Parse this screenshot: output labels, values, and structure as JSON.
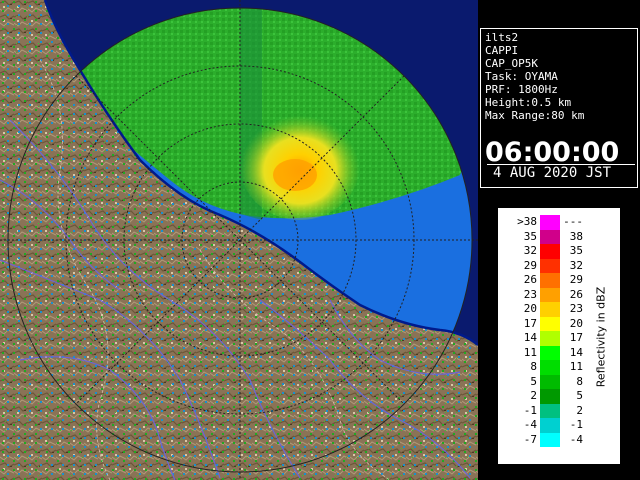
{
  "info": {
    "site": "ilts2",
    "product": "CAPPI",
    "product_code": "CAP_OP5K",
    "task": "Task: OYAMA",
    "prf": "PRF: 1800Hz",
    "height": "Height:0.5 km",
    "max_range": "Max Range:80 km",
    "time": "06:00:00",
    "date": "4 AUG 2020 JST"
  },
  "legend": {
    "title": "Reflectivity in dBZ",
    "rows": [
      {
        "left": ">38",
        "right": "---",
        "color": "#ff00ff"
      },
      {
        "left": "35",
        "right": "38",
        "color": "#d0008a"
      },
      {
        "left": "32",
        "right": "35",
        "color": "#ff0000"
      },
      {
        "left": "29",
        "right": "32",
        "color": "#ff3000"
      },
      {
        "left": "26",
        "right": "29",
        "color": "#ff7000"
      },
      {
        "left": "23",
        "right": "26",
        "color": "#ffa000"
      },
      {
        "left": "20",
        "right": "23",
        "color": "#ffd000"
      },
      {
        "left": "17",
        "right": "20",
        "color": "#ffff00"
      },
      {
        "left": "14",
        "right": "17",
        "color": "#b0ff00"
      },
      {
        "left": "11",
        "right": "14",
        "color": "#00ff00"
      },
      {
        "left": "8",
        "right": "11",
        "color": "#00dd00"
      },
      {
        "left": "5",
        "right": "8",
        "color": "#00bb00"
      },
      {
        "left": "2",
        "right": "5",
        "color": "#009900"
      },
      {
        "left": "-1",
        "right": "2",
        "color": "#00c080"
      },
      {
        "left": "-4",
        "right": "-1",
        "color": "#00d0d0"
      },
      {
        "left": "-7",
        "right": "-4",
        "color": "#00ffff"
      }
    ]
  },
  "map": {
    "land_color": "#8a7356",
    "sea_color": "#0a1a6e",
    "echo_green": "#2cae2c",
    "echo_blue": "#1a6fe0",
    "core_yellow": "#e8d020",
    "river_color": "#6a64d8",
    "grid_color": "#222222"
  }
}
